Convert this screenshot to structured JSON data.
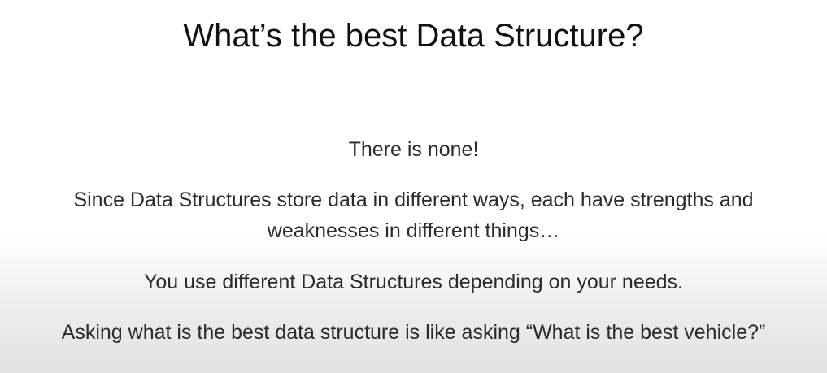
{
  "slide": {
    "title": "What’s the best Data Structure?",
    "paragraphs": {
      "none": "There is none!",
      "strengths_line1": "Since Data Structures store data in different ways, each have strengths and",
      "strengths_line2": "weaknesses in different things…",
      "needs": "You use different Data Structures depending on your needs.",
      "vehicle": "Asking what is the best data structure is like asking “What is the best vehicle?”"
    }
  }
}
